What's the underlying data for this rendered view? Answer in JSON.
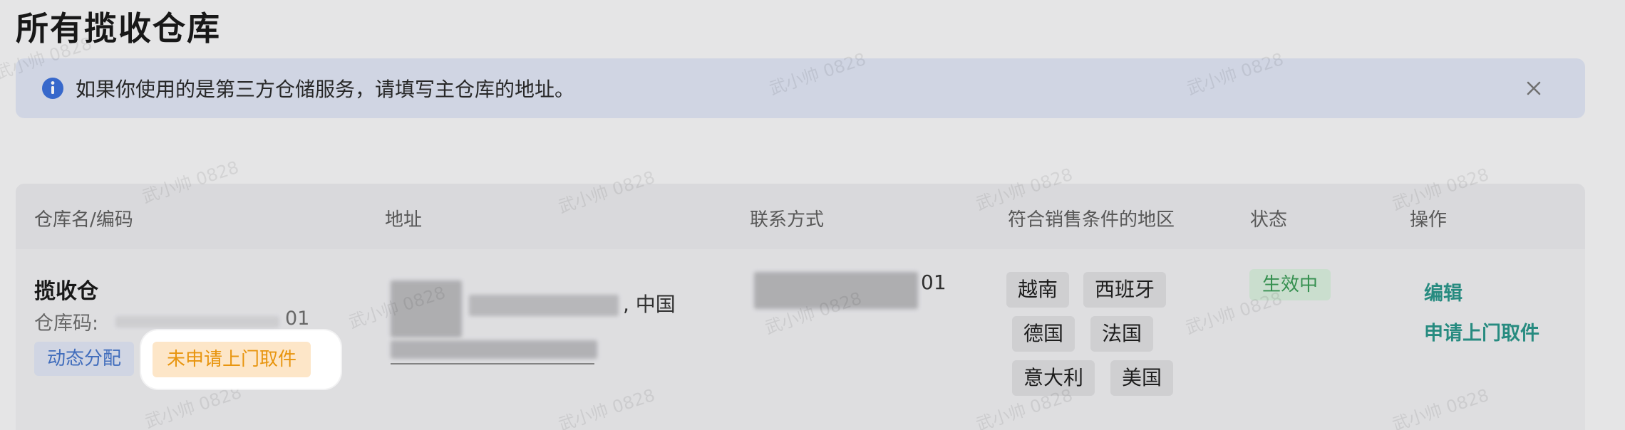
{
  "page": {
    "title": "所有揽收仓库"
  },
  "alert": {
    "message": "如果你使用的是第三方仓储服务，请填写主仓库的地址。",
    "info_icon": "info-icon",
    "close_icon": "close-icon"
  },
  "table": {
    "headers": [
      "仓库名/编码",
      "地址",
      "联系方式",
      "符合销售条件的地区",
      "状态",
      "操作"
    ],
    "row": {
      "name": "揽收仓",
      "code_label": "仓库码:",
      "code_tail": "01",
      "tags": [
        "动态分配",
        "未申请上门取件"
      ],
      "address_suffix": ", 中国",
      "contact_tail": "01",
      "regions": [
        "越南",
        "西班牙",
        "德国",
        "法国",
        "意大利",
        "美国"
      ],
      "status": "生效中",
      "actions": [
        "编辑",
        "申请上门取件"
      ]
    }
  },
  "watermark": "武小帅 0828",
  "colors": {
    "accent_teal": "#2a9488",
    "info_blue": "#3b6fd8",
    "tag_orange": "#e8950f",
    "status_green": "#3a9a55"
  }
}
